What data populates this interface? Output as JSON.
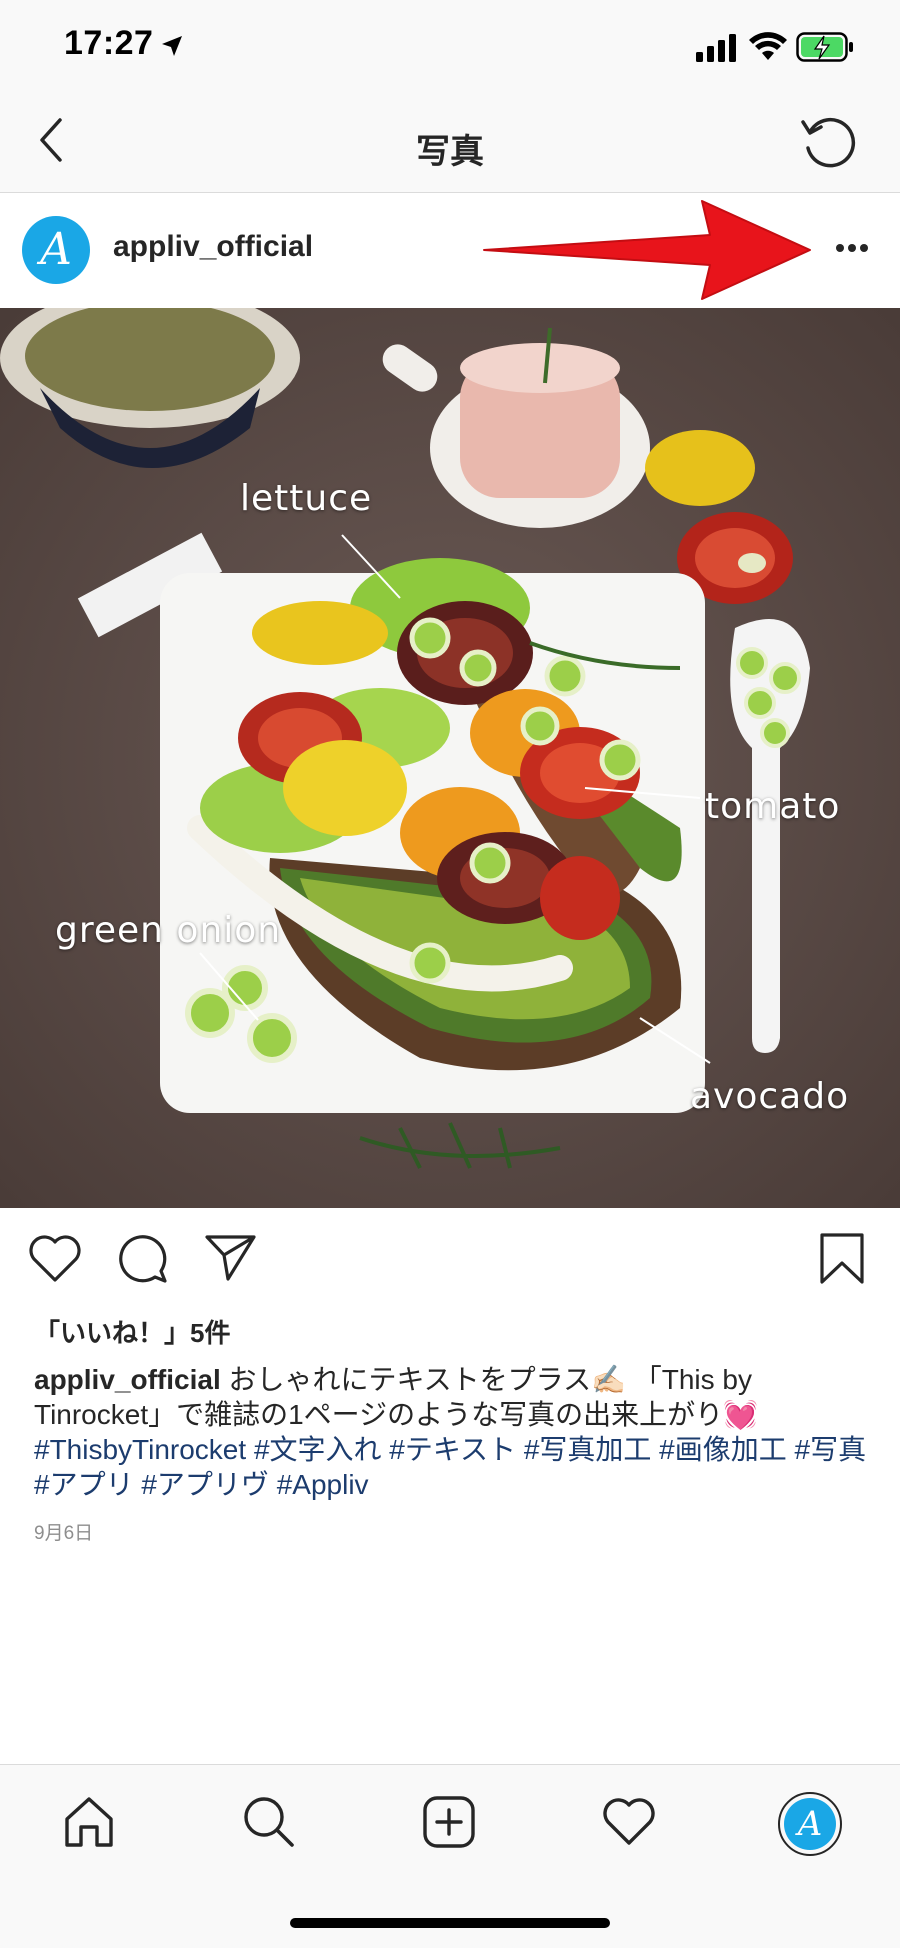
{
  "status_bar": {
    "time": "17:27",
    "icons": [
      "location-arrow-icon",
      "cellular-signal-icon",
      "wifi-icon",
      "battery-charging-icon"
    ]
  },
  "nav": {
    "title": "写真",
    "back_icon": "chevron-left-icon",
    "refresh_icon": "refresh-icon"
  },
  "post": {
    "username": "appliv_official",
    "avatar_letter": "A",
    "more_icon": "more-dots-icon",
    "photo_labels": {
      "lettuce": "lettuce",
      "tomato": "tomato",
      "green_onion": "green onion",
      "avocado": "avocado"
    },
    "likes": "「いいね！」5件",
    "caption": {
      "username": "appliv_official",
      "text_1": " おしゃれにテキストをプラス✍🏻 「This by Tinrocket」で雑誌の1ページのような写真の出来上がり💓",
      "hashtags": [
        "#ThisbyTinrocket",
        "#文字入れ",
        "#テキスト",
        "#写真加工",
        "#画像加工",
        "#写真",
        "#アプリ",
        "#アプリヴ",
        "#Appliv"
      ]
    },
    "date": "9月6日"
  },
  "tab_bar": {
    "items": [
      "home-icon",
      "search-icon",
      "add-post-icon",
      "activity-heart-icon",
      "profile-avatar-icon"
    ],
    "profile_letter": "A"
  },
  "colors": {
    "accent_avatar": "#1aa7e6",
    "annotation_arrow": "#e8141b",
    "hashtag": "#1c3c6e",
    "battery_green": "#4cd964"
  }
}
